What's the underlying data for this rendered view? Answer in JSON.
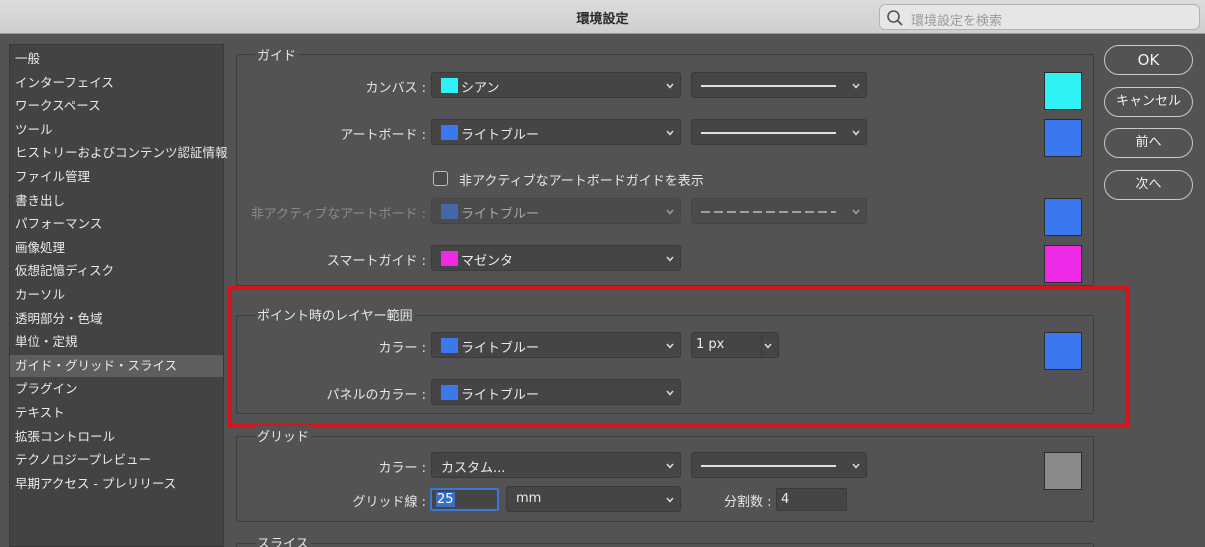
{
  "window": {
    "title": "環境設定",
    "search_placeholder": "環境設定を検索"
  },
  "sidebar": {
    "items": [
      {
        "label": "一般"
      },
      {
        "label": "インターフェイス"
      },
      {
        "label": "ワークスペース"
      },
      {
        "label": "ツール"
      },
      {
        "label": "ヒストリーおよびコンテンツ認証情報"
      },
      {
        "label": "ファイル管理"
      },
      {
        "label": "書き出し"
      },
      {
        "label": "パフォーマンス"
      },
      {
        "label": "画像処理"
      },
      {
        "label": "仮想記憶ディスク"
      },
      {
        "label": "カーソル"
      },
      {
        "label": "透明部分・色域"
      },
      {
        "label": "単位・定規"
      },
      {
        "label": "ガイド・グリッド・スライス",
        "selected": true
      },
      {
        "label": "プラグイン"
      },
      {
        "label": "テキスト"
      },
      {
        "label": "拡張コントロール"
      },
      {
        "label": "テクノロジープレビュー"
      },
      {
        "label": "早期アクセス - プレリリース"
      }
    ]
  },
  "guides": {
    "section_label": "ガイド",
    "canvas": {
      "label": "カンバス :",
      "color": "シアン",
      "swatch": "#2ff2f4"
    },
    "artboard": {
      "label": "アートボード :",
      "color": "ライトブルー",
      "swatch": "#3b78f0"
    },
    "inactive_checkbox_label": "非アクティブなアートボードガイドを表示",
    "inactive": {
      "label": "非アクティブなアートボード :",
      "color": "ライトブルー",
      "swatch": "#3b78f0"
    },
    "smart": {
      "label": "スマートガイド :",
      "color": "マゼンタ",
      "swatch": "#ee2ae6"
    }
  },
  "hover_layer": {
    "section_label": "ポイント時のレイヤー範囲",
    "color": {
      "label": "カラー :",
      "value": "ライトブルー",
      "swatch": "#3b78f0"
    },
    "stroke_width": "1 px",
    "panel_color": {
      "label": "パネルのカラー :",
      "value": "ライトブルー",
      "swatch": "#3b78f0"
    }
  },
  "grid": {
    "section_label": "グリッド",
    "color": {
      "label": "カラー :",
      "value": "カスタム...",
      "swatch": "#8a8a8a"
    },
    "gridline_label": "グリッド線 :",
    "gridline_value": "25",
    "gridline_unit": "mm",
    "subdivisions_label": "分割数 :",
    "subdivisions_value": "4"
  },
  "slice": {
    "section_label": "スライス"
  },
  "buttons": {
    "ok": "OK",
    "cancel": "キャンセル",
    "prev": "前へ",
    "next": "次へ"
  },
  "colors": {
    "highlight": "#d6141b",
    "selection_blue": "#3a6fc7"
  }
}
